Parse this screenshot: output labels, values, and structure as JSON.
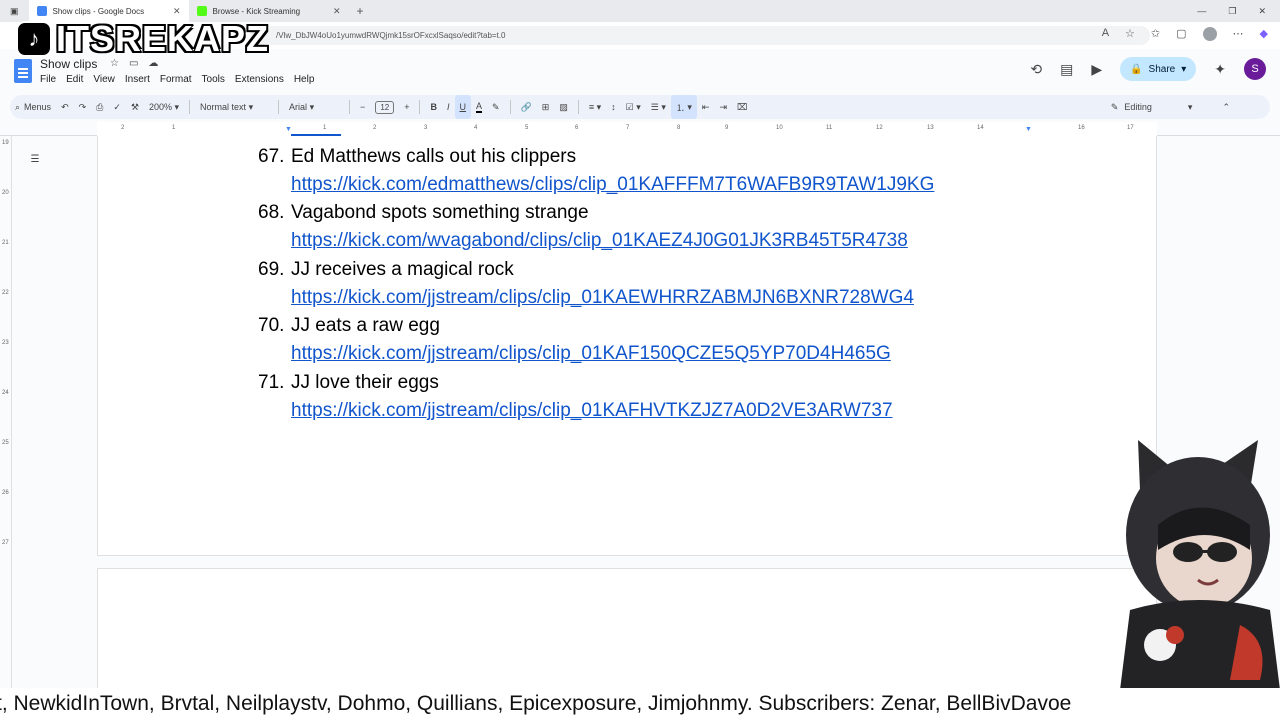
{
  "browser": {
    "tabs": [
      {
        "title": "Show clips - Google Docs",
        "active": true,
        "favicon_color": "#4285f4"
      },
      {
        "title": "Browse - Kick Streaming",
        "active": false,
        "favicon_color": "#53fc18"
      }
    ],
    "url": "/Vlw_DbJW4oUo1yumwdRWQjmk15srOFxcxlSaqso/edit?tab=t.0"
  },
  "overlay": {
    "channel_name": "ITSREKAPZ"
  },
  "docs": {
    "title": "Show clips",
    "menu": [
      "File",
      "Edit",
      "View",
      "Insert",
      "Format",
      "Tools",
      "Extensions",
      "Help"
    ],
    "share_label": "Share",
    "user_initial": "S"
  },
  "toolbar": {
    "search_label": "Menus",
    "zoom": "200%",
    "style": "Normal text",
    "font": "Arial",
    "font_size": "12",
    "mode": "Editing"
  },
  "ruler": {
    "numbers": [
      "2",
      "1",
      "1",
      "2",
      "3",
      "4",
      "5",
      "6",
      "7",
      "8",
      "9",
      "10",
      "11",
      "12",
      "13",
      "14",
      "15",
      "16",
      "17",
      "18"
    ],
    "vertical_numbers": [
      "19",
      "20",
      "21",
      "22",
      "23",
      "24",
      "25",
      "26",
      "27"
    ]
  },
  "document": {
    "items": [
      {
        "number": "67.",
        "title": "Ed Matthews calls out his clippers",
        "link": "https://kick.com/edmatthews/clips/clip_01KAFFFM7T6WAFB9R9TAW1J9KG"
      },
      {
        "number": "68.",
        "title": "Vagabond spots something strange",
        "link": "https://kick.com/wvagabond/clips/clip_01KAEZ4J0G01JK3RB45T5R4738"
      },
      {
        "number": "69.",
        "title": "JJ receives a magical rock",
        "link": "https://kick.com/jjstream/clips/clip_01KAEWHRRZABMJN6BXNR728WG4"
      },
      {
        "number": "70.",
        "title": "JJ eats a raw egg",
        "link": "https://kick.com/jjstream/clips/clip_01KAF150QCZE5Q5YP70D4H465G"
      },
      {
        "number": "71.",
        "title": "JJ love their eggs",
        "link": "https://kick.com/jjstream/clips/clip_01KAFHVTKZJZ7A0D2VE3ARW737"
      }
    ]
  },
  "ticker": {
    "text": "t, NewkidInTown, Brvtal, Neilplaystv, Dohmo, Quillians, Epicexposure, Jimjohnmy.  Subscribers: Zenar, BellBivDavoe"
  },
  "colors": {
    "link": "#1155cc",
    "share_bg": "#c2e7ff",
    "toolbar_bg": "#edf2fa",
    "docs_blue": "#4285f4"
  }
}
